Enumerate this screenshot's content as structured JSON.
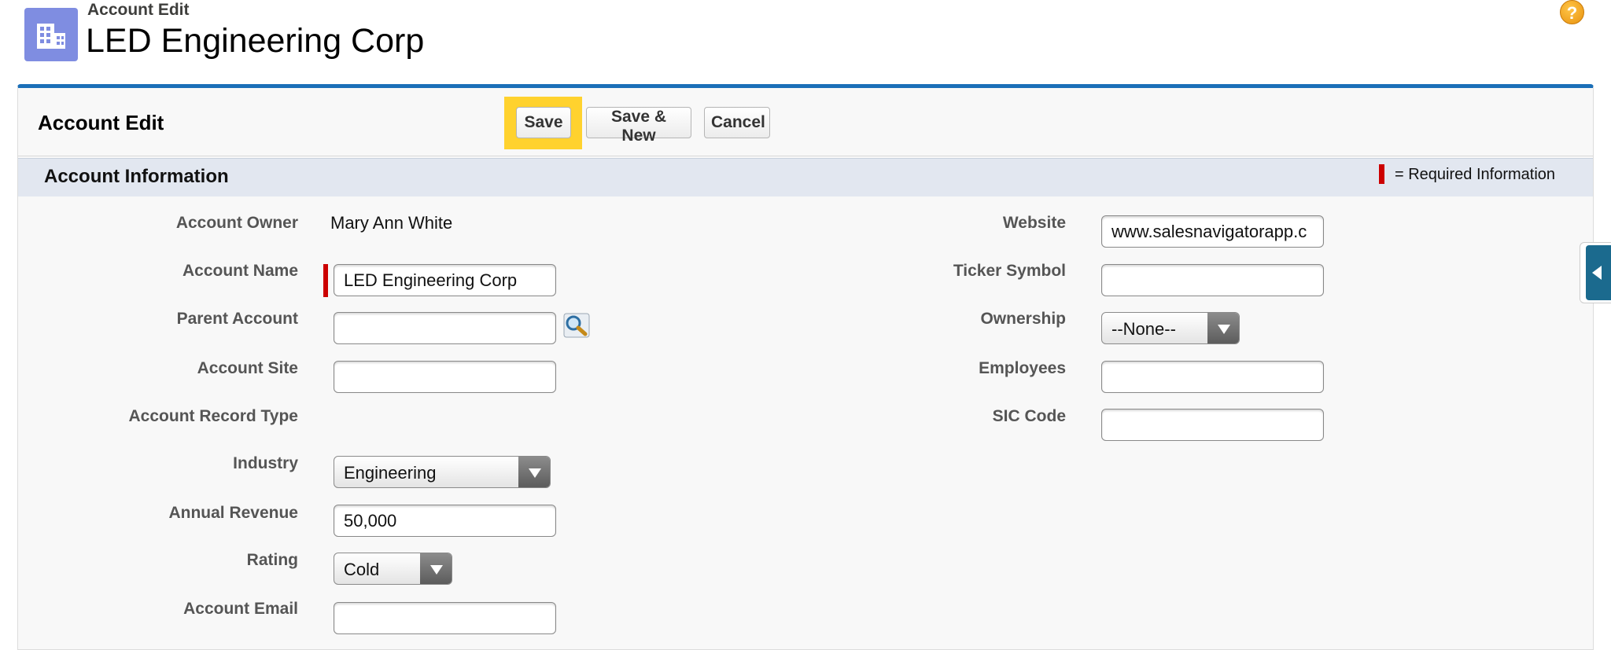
{
  "header": {
    "subtitle": "Account Edit",
    "title": "LED Engineering Corp",
    "icon": "building-icon",
    "help_icon": "help-icon",
    "help_glyph": "?"
  },
  "panel": {
    "title": "Account Edit",
    "buttons": {
      "save": "Save",
      "save_new": "Save & New",
      "cancel": "Cancel"
    }
  },
  "section": {
    "title": "Account Information",
    "required_legend": "= Required Information"
  },
  "left_fields": {
    "account_owner": {
      "label": "Account Owner",
      "value": "Mary Ann White"
    },
    "account_name": {
      "label": "Account Name",
      "value": "LED Engineering Corp"
    },
    "parent_account": {
      "label": "Parent Account",
      "value": ""
    },
    "account_site": {
      "label": "Account Site",
      "value": ""
    },
    "record_type": {
      "label": "Account Record Type"
    },
    "industry": {
      "label": "Industry",
      "value": "Engineering"
    },
    "annual_revenue": {
      "label": "Annual Revenue",
      "value": "50,000"
    },
    "rating": {
      "label": "Rating",
      "value": "Cold"
    },
    "account_email": {
      "label": "Account Email",
      "value": ""
    }
  },
  "right_fields": {
    "website": {
      "label": "Website",
      "value": "www.salesnavigatorapp.c"
    },
    "ticker_symbol": {
      "label": "Ticker Symbol",
      "value": ""
    },
    "ownership": {
      "label": "Ownership",
      "value": "--None--"
    },
    "employees": {
      "label": "Employees",
      "value": ""
    },
    "sic_code": {
      "label": "SIC Code",
      "value": ""
    }
  },
  "colors": {
    "accent_blue": "#1b6fb8",
    "highlight_yellow": "#ffd22e",
    "required_red": "#cc0000",
    "icon_bg": "#7f8de1"
  }
}
